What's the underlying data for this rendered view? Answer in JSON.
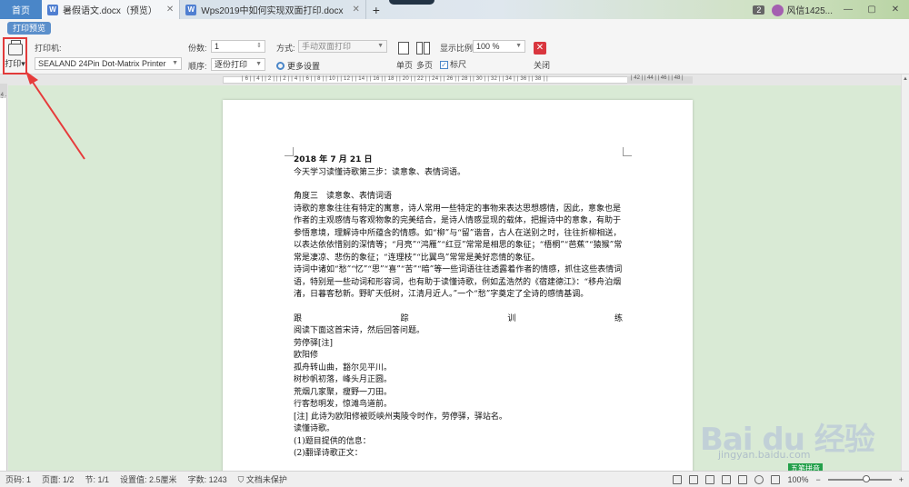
{
  "tabs": {
    "home": "首页",
    "doc1": "暑假语文.docx（预览）",
    "doc2": "Wps2019中如何实现双面打印.docx",
    "add": "+",
    "badge": "2",
    "user": "风信1425..."
  },
  "mode": {
    "print_preview": "打印预览"
  },
  "ribbon": {
    "print_label": "打印",
    "printer_label": "打印机:",
    "printer_value": "SEALAND 24Pin Dot-Matrix Printer",
    "copies_label": "份数:",
    "copies_value": "1",
    "order_label": "顺序:",
    "order_value": "逐份打印",
    "method_label": "方式:",
    "method_value": "手动双面打印",
    "more_settings": "更多设置",
    "single_page": "单页",
    "multi_page": "多页",
    "scale_label": "显示比例",
    "scale_value": "100 %",
    "ruler_label": "标尺",
    "close_label": "关闭"
  },
  "ruler": {
    "ticks": "| 6 |   | 4 |   | 2 |   |   | 2 |   | 4 |   | 6 |   | 8 |   | 10 |   | 12 |   | 14 |   | 16 |   | 18 |   | 20 |   | 22 |   | 24 |   | 26 |   | 28 |   | 30 |   | 32 |   | 34 |   | 36 |   | 38 |   |",
    "right_ticks": "| 42 |  | 44 |  | 46 |  | 48 |",
    "vertical": "4 . 2 . 1 . 2"
  },
  "document": {
    "date": "2018 年 7 月 21 日",
    "intro": "今天学习读懂诗歌第三步：读意象、表情词语。",
    "section": "角度三　读意象、表情词语",
    "p1": "诗歌的意象往往有特定的寓意，诗人常用一些特定的事物来表达思想感情，因此，意象也是作者的主观感情与客观物象的完美结合，是诗人情感显现的载体，把握诗中的意象，有助于参悟意境，理解诗中所蕴含的情感。如“柳”与“留”谐音，古人在送别之时，往往折柳相送，以表达依依惜别的深情等；“月亮”“鸿雁”“红豆”常常是相思的象征；“梧桐”“芭蕉”“猿猴”常常是凄凉、悲伤的象征；“连理枝”“比翼鸟”常常是美好恋情的象征。",
    "p2": "诗词中诸如“愁”“忆”“思”“喜”“苦”“暗”等一些词语往往透露着作者的情感，抓住这些表情词语，特别是一些动词和形容词，也有助于读懂诗歌，例如孟浩然的《宿建德江》：“移舟泊烟渚，日暮客愁新。野旷天低树，江清月近人。”一个“愁”字奠定了全诗的感情基调。",
    "train": [
      "跟",
      "踪",
      "训",
      "练"
    ],
    "q": "阅读下面这首宋诗，然后回答问题。",
    "poem_title": "劳停驿[注]",
    "author": "欧阳修",
    "l1": "孤舟转山曲，豁尔见平川。",
    "l2": "树杪帆初落，峰头月正圆。",
    "l3": "荒烟几家聚，瘦野一刀田。",
    "l4": "行客愁明发，惊滩鸟道前。",
    "note": "[注] 此诗为欧阳修被贬峡州夷陵令时作，劳停驿，驿站名。",
    "read": "读懂诗歌。",
    "q1": "(1)题目提供的信息：",
    "q2": "(2)翻译诗歌正文："
  },
  "status": {
    "page": "页码: 1",
    "pages": "页面: 1/2",
    "section": "节: 1/1",
    "setting": "设置值: 2.5厘米",
    "words": "字数: 1243",
    "protect": "文档未保护",
    "zoom": "100%",
    "ime": "五笔拼音"
  },
  "watermark": {
    "brand": "Bai du 经验",
    "url": "jingyan.baidu.com"
  },
  "colors": {
    "accent": "#4a86c8",
    "highlight": "#e23a3a",
    "workspace": "#d9ead5"
  }
}
